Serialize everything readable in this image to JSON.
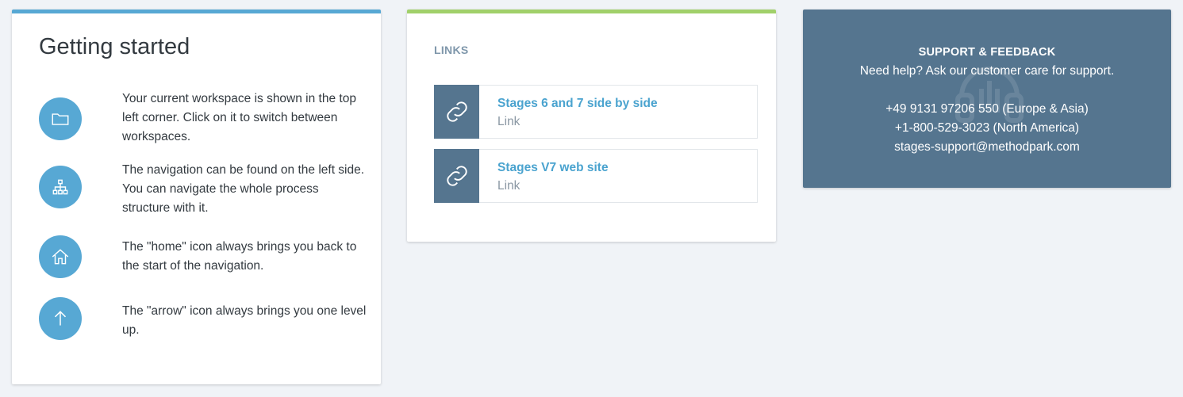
{
  "getting_started": {
    "title": "Getting started",
    "items": [
      {
        "icon": "folder-icon",
        "text": "Your current workspace is shown in the top left corner. Click on it to switch between workspaces."
      },
      {
        "icon": "sitemap-icon",
        "text": "The navigation can be found on the left side. You can navigate the whole process structure with it."
      },
      {
        "icon": "home-icon",
        "text": "The \"home\" icon always brings you back to the start of the navigation."
      },
      {
        "icon": "arrow-up-icon",
        "text": "The \"arrow\" icon always brings you one level up."
      }
    ],
    "accent": "#57a8d4"
  },
  "links": {
    "heading": "LINKS",
    "items": [
      {
        "title": "Stages 6 and 7 side by side",
        "type": "Link",
        "icon": "link-icon"
      },
      {
        "title": "Stages V7 web site",
        "type": "Link",
        "icon": "link-icon"
      }
    ],
    "accent": "#a1d06a"
  },
  "support": {
    "title": "SUPPORT & FEEDBACK",
    "subtitle": "Need help? Ask our customer care for support.",
    "phone_europe": "+49 9131 97206 550 (Europe & Asia)",
    "phone_america": "+1-800-529-3023 (North America)",
    "email": "stages-support@methodpark.com",
    "background": "#55758f"
  }
}
